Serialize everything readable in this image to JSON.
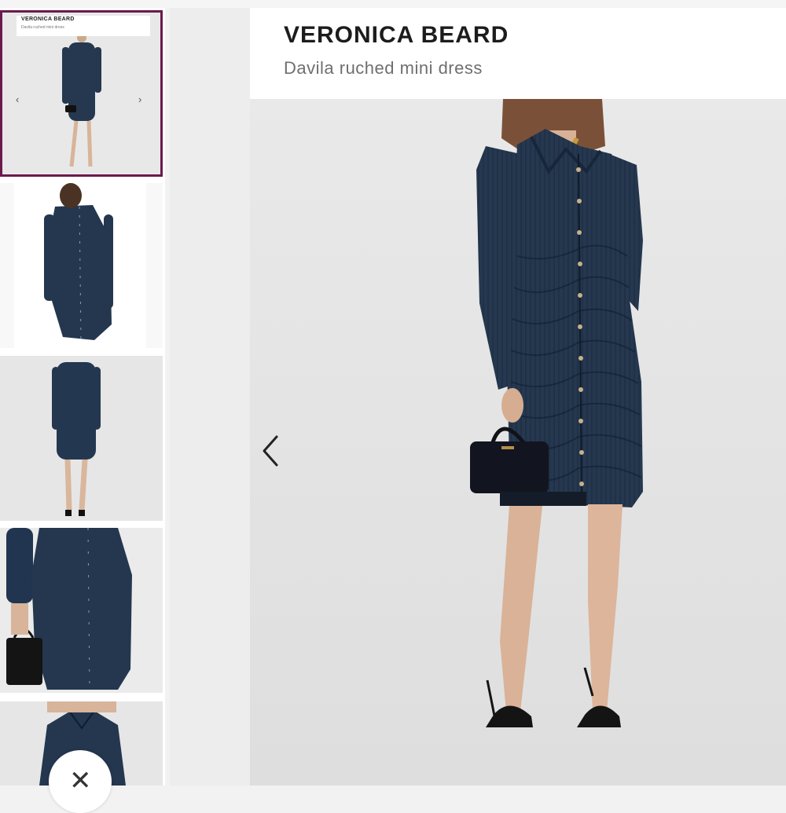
{
  "product": {
    "brand": "VERONICA BEARD",
    "name": "Davila ruched mini dress"
  },
  "thumbnails": {
    "selected_index": 0,
    "first": {
      "brand": "VERONICA BEARD",
      "name": "Davila ruched mini dress"
    },
    "arrow_left": "‹",
    "arrow_right": "›"
  },
  "close": {
    "glyph": "✕"
  },
  "colors": {
    "accent_border": "#6b1a4d",
    "dress_navy": "#243750"
  },
  "icons": [
    "chevron-left-icon",
    "chevron-right-icon",
    "close-icon"
  ]
}
